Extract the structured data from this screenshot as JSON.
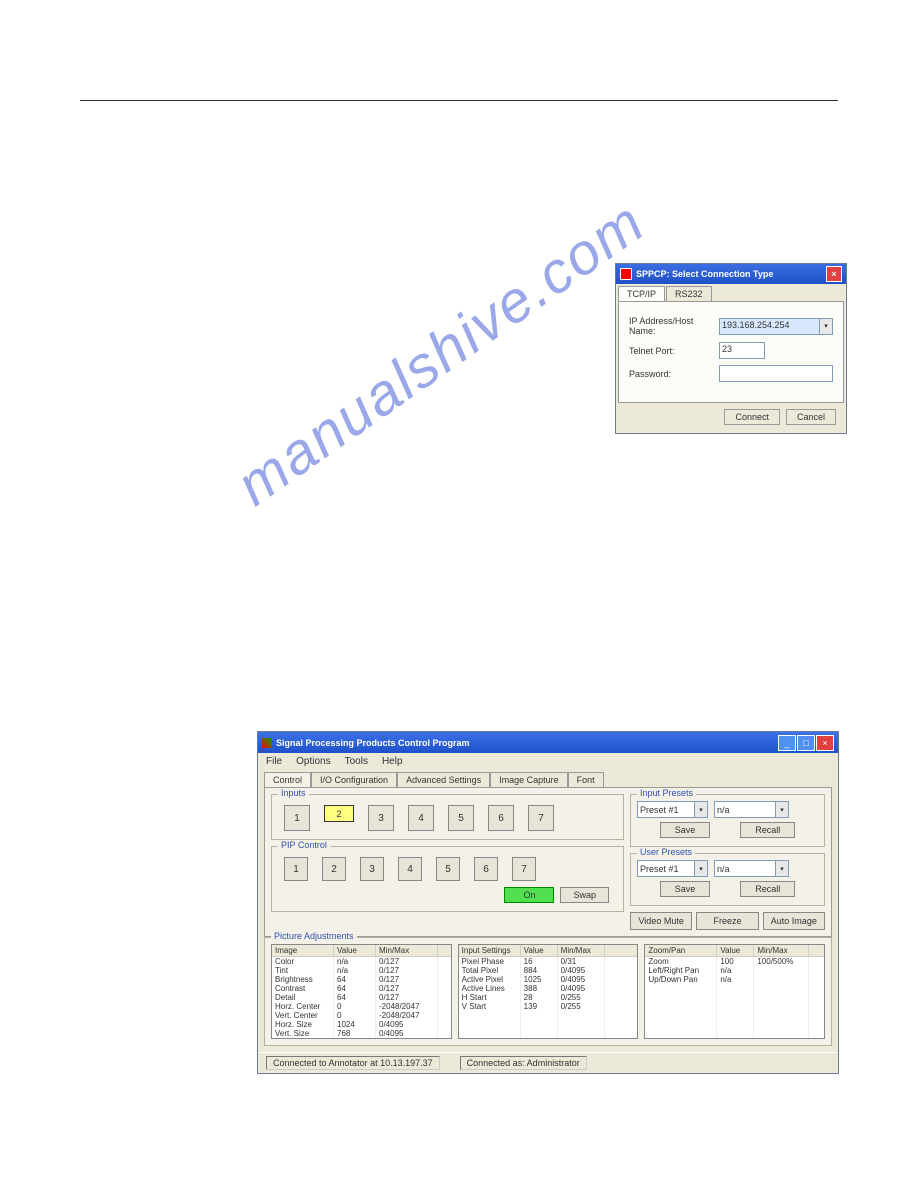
{
  "dialog": {
    "title": "SPPCP:  Select Connection Type",
    "tabs": [
      "TCP/IP",
      "RS232"
    ],
    "ip_label": "IP Address/Host Name:",
    "ip_value": "193.168.254.254",
    "port_label": "Telnet Port:",
    "port_value": "23",
    "pass_label": "Password:",
    "pass_value": "",
    "connect": "Connect",
    "cancel": "Cancel"
  },
  "win": {
    "title": "Signal Processing Products Control Program",
    "menus": [
      "File",
      "Options",
      "Tools",
      "Help"
    ],
    "tabs": [
      "Control",
      "I/O Configuration",
      "Advanced Settings",
      "Image Capture",
      "Font"
    ],
    "inputs_label": "Inputs",
    "inputs": [
      "1",
      "2",
      "3",
      "4",
      "5",
      "6",
      "7"
    ],
    "pip_label": "PIP Control",
    "pip": [
      "1",
      "2",
      "3",
      "4",
      "5",
      "6",
      "7"
    ],
    "on": "On",
    "swap": "Swap",
    "ip_label": "Input Presets",
    "up_label": "User Presets",
    "preset_sel": "Preset #1",
    "na": "n/a",
    "save": "Save",
    "recall": "Recall",
    "vmute": "Video Mute",
    "freeze": "Freeze",
    "autoimg": "Auto Image",
    "pa_label": "Picture Adjustments",
    "tbl1": {
      "h": [
        "Image",
        "Value",
        "Min/Max"
      ],
      "rows": [
        [
          "Color",
          "n/a",
          "0/127"
        ],
        [
          "Tint",
          "n/a",
          "0/127"
        ],
        [
          "Brightness",
          "64",
          "0/127"
        ],
        [
          "Contrast",
          "64",
          "0/127"
        ],
        [
          "Detail",
          "64",
          "0/127"
        ],
        [
          "Horz. Center",
          "0",
          "-2048/2047"
        ],
        [
          "Vert. Center",
          "0",
          "-2048/2047"
        ],
        [
          "Horz. Size",
          "1024",
          "0/4095"
        ],
        [
          "Vert. Size",
          "768",
          "0/4095"
        ]
      ]
    },
    "tbl2": {
      "h": [
        "Input Settings",
        "Value",
        "Min/Max"
      ],
      "rows": [
        [
          "Pixel Phase",
          "16",
          "0/31"
        ],
        [
          "Total Pixel",
          "884",
          "0/4095"
        ],
        [
          "Active Pixel",
          "1025",
          "0/4095"
        ],
        [
          "Active Lines",
          "388",
          "0/4095"
        ],
        [
          "H Start",
          "28",
          "0/255"
        ],
        [
          "V Start",
          "139",
          "0/255"
        ]
      ]
    },
    "tbl3": {
      "h": [
        "Zoom/Pan",
        "Value",
        "Min/Max"
      ],
      "rows": [
        [
          "Zoom",
          "100",
          "100/500%"
        ],
        [
          "Left/Right Pan",
          "n/a",
          ""
        ],
        [
          "Up/Down Pan",
          "n/a",
          ""
        ]
      ]
    },
    "status1": "Connected to Annotator at 10.13.197.37",
    "status2": "Connected as: Administrator"
  },
  "watermark": "manualshive.com"
}
